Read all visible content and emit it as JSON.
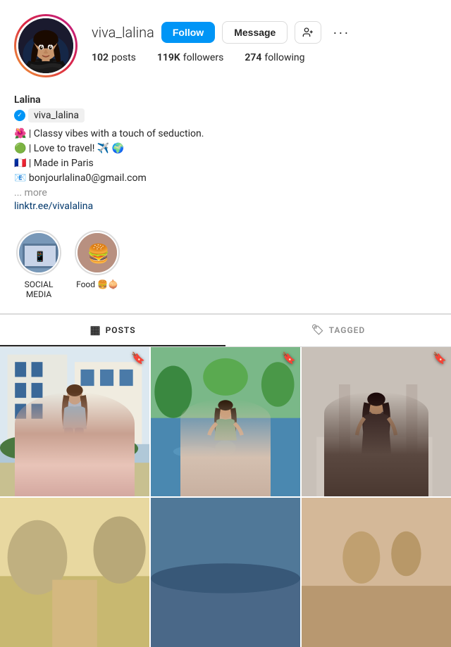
{
  "header": {
    "username": "viva_lalina",
    "follow_label": "Follow",
    "message_label": "Message"
  },
  "stats": {
    "posts_count": "102",
    "posts_label": "posts",
    "followers_count": "119K",
    "followers_label": "followers",
    "following_count": "274",
    "following_label": "following"
  },
  "bio": {
    "name": "Lalina",
    "verified_username": "viva_lalina",
    "line1": "🌺 | Classy vibes with a touch of seduction.",
    "line2": "🟢 | Love to travel! ✈️ 🌍",
    "line3": "🇫🇷 | Made in Paris",
    "line4": "📧 bonjourlalina0@gmail.com",
    "more": "... more",
    "link": "linktr.ee/vivalalina"
  },
  "highlights": [
    {
      "label": "SOCIAL MEDIA"
    },
    {
      "label": "Food 🍔🧅"
    }
  ],
  "tabs": [
    {
      "label": "POSTS",
      "active": true
    },
    {
      "label": "TAGGED",
      "active": false
    }
  ],
  "photos": [
    {
      "alt": "Photo 1"
    },
    {
      "alt": "Photo 2"
    },
    {
      "alt": "Photo 3"
    },
    {
      "alt": "Photo 4"
    },
    {
      "alt": "Photo 5"
    },
    {
      "alt": "Photo 6"
    }
  ],
  "icons": {
    "more": "···",
    "grid": "▦",
    "tag": "🏷",
    "bookmark": "🔖"
  }
}
